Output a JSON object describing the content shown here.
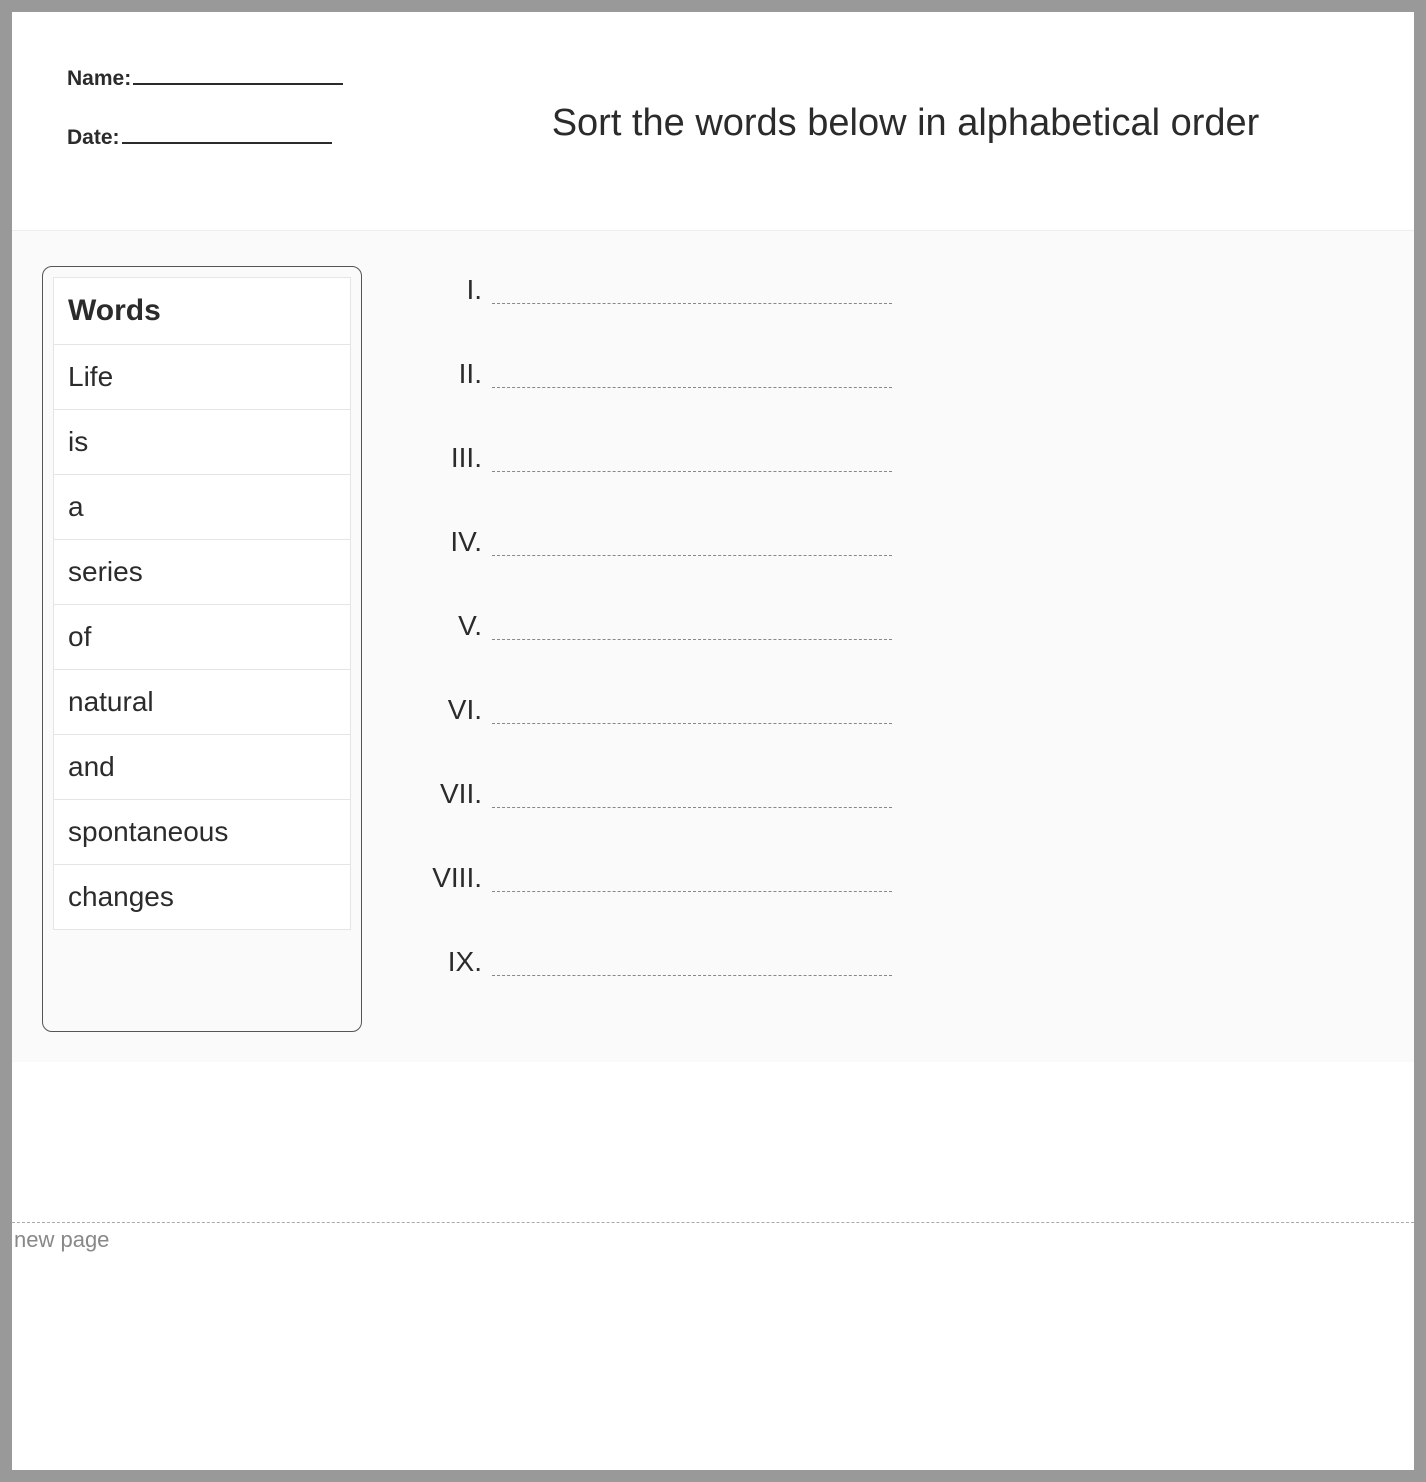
{
  "header": {
    "name_label": "Name:",
    "date_label": "Date:",
    "title": "Sort the words below in alphabetical order"
  },
  "words_panel": {
    "heading": "Words",
    "items": [
      "Life",
      "is",
      "a",
      "series",
      "of",
      "natural",
      "and",
      "spontaneous",
      "changes"
    ]
  },
  "answer_slots": [
    "I.",
    "II.",
    "III.",
    "IV.",
    "V.",
    "VI.",
    "VII.",
    "VIII.",
    "IX."
  ],
  "page_break_label": "new page"
}
